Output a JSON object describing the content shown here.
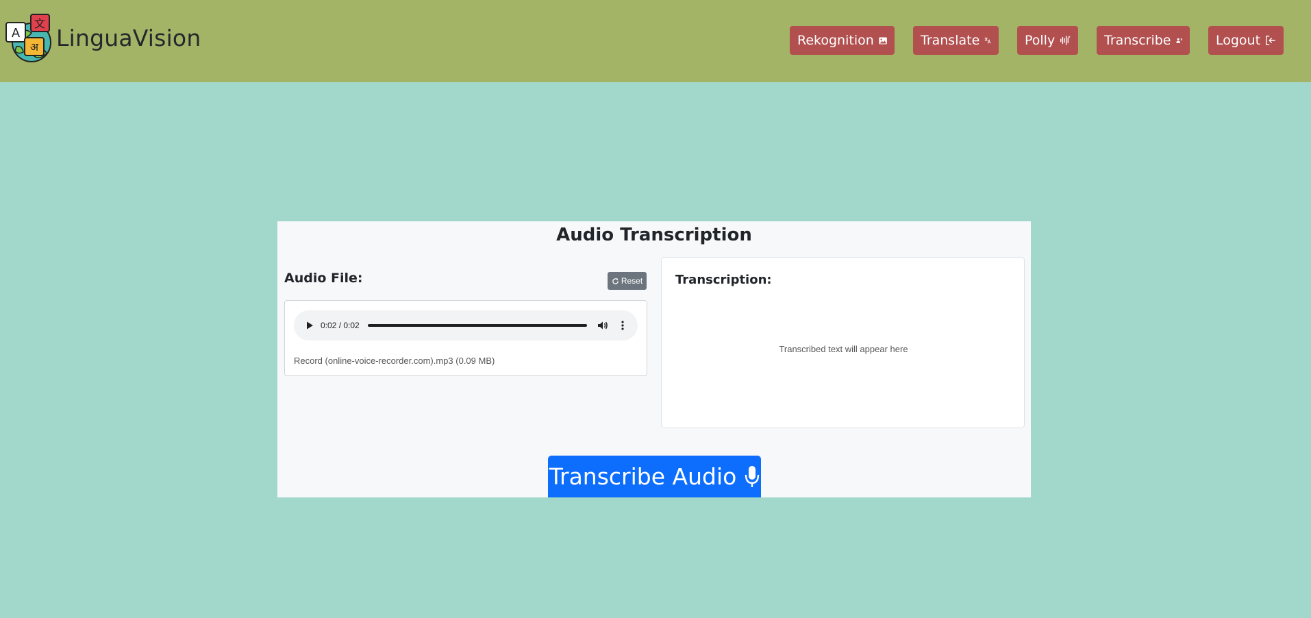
{
  "app": {
    "name": "LinguaVision",
    "logo_glyphs": [
      "A",
      "文",
      "अ"
    ]
  },
  "nav": {
    "items": [
      {
        "label": "Rekognition",
        "icon": "image-icon"
      },
      {
        "label": "Translate",
        "icon": "translate-icon"
      },
      {
        "label": "Polly",
        "icon": "soundwave-icon"
      },
      {
        "label": "Transcribe",
        "icon": "person-voice-icon"
      },
      {
        "label": "Logout",
        "icon": "logout-icon"
      }
    ]
  },
  "main": {
    "title": "Audio Transcription",
    "audio_label": "Audio File:",
    "reset_label": "Reset",
    "player": {
      "time": "0:02 / 0:02",
      "progress": 1.0
    },
    "file_info": "Record (online-voice-recorder.com).mp3 (0.09 MB)",
    "transcription_label": "Transcription:",
    "transcription_placeholder": "Transcribed text will appear here",
    "transcribe_button": "Transcribe Audio"
  },
  "colors": {
    "navbar": "#a3b467",
    "background": "#a2d8cb",
    "nav_button": "#b24f4f",
    "primary": "#0d6efd",
    "secondary": "#6c757d"
  }
}
